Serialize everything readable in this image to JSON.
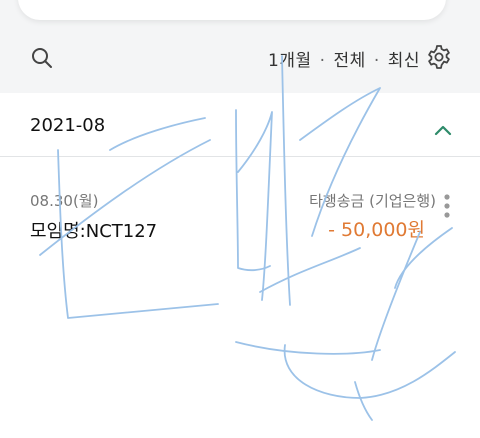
{
  "filter": {
    "period": "1개월",
    "type": "전체",
    "sort": "최신",
    "separator": "·"
  },
  "month": {
    "label": "2021-08"
  },
  "transactions": [
    {
      "date": "08.30(월)",
      "memo": "모임명:NCT127",
      "type": "타행송금 (기업은행)",
      "amount": "- 50,000원"
    }
  ],
  "colors": {
    "amount": "#e07a34",
    "accent": "#2e8b6a",
    "scribble": "#9cc2e8"
  },
  "icons": [
    "search-icon",
    "settings-icon",
    "chevron-up-icon",
    "more-icon"
  ]
}
